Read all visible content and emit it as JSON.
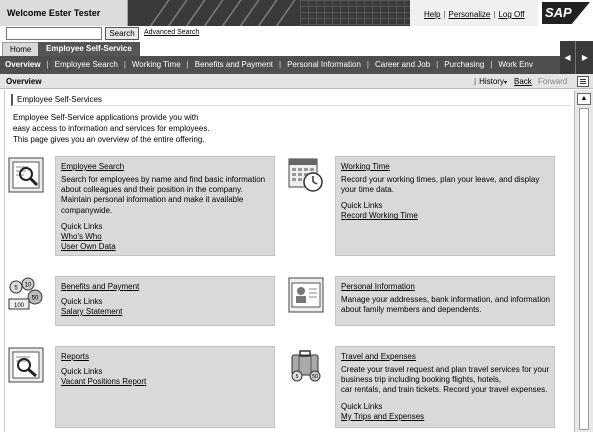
{
  "header": {
    "welcome": "Welcome Ester Tester",
    "links": [
      "Help",
      "Personalize",
      "Log Off"
    ],
    "logo_text": "SAP"
  },
  "search": {
    "value": "",
    "button": "Search",
    "advanced": "Advanced Search"
  },
  "tabs": [
    {
      "label": "Home",
      "active": false
    },
    {
      "label": "Employee Self-Service",
      "active": true
    }
  ],
  "nav": {
    "items": [
      "Overview",
      "Employee Search",
      "Working Time",
      "Benefits and Payment",
      "Personal Information",
      "Career and Job",
      "Purchasing",
      "Work Env"
    ]
  },
  "overview_bar": {
    "title": "Overview",
    "history": "History",
    "back": "Back",
    "forward": "Forward"
  },
  "content": {
    "section_title": "Employee Self-Services",
    "intro_lines": [
      "Employee Self-Service applications provide you with",
      "easy access to information and services for employees.",
      "This page gives you an overview of the entire offering."
    ],
    "quick_links_label": "Quick Links"
  },
  "cards": {
    "employee_search": {
      "title": "Employee Search",
      "desc_lines": [
        "Search for employees by name and find basic information",
        "about colleagues and their position in the company.",
        "Maintain personal information and make it available",
        "companywide."
      ],
      "links": [
        "Who's Who",
        "User Own Data"
      ]
    },
    "working_time": {
      "title": "Working Time",
      "desc_lines": [
        "Record your working times, plan your leave, and display",
        "your time data."
      ],
      "links": [
        "Record Working Time"
      ]
    },
    "benefits": {
      "title": "Benefits and Payment",
      "desc_lines": [],
      "links": [
        "Salary Statement"
      ]
    },
    "personal_info": {
      "title": "Personal Information",
      "desc_lines": [
        "Manage your addresses, bank information, and information",
        "about family members and dependents."
      ],
      "links": []
    },
    "reports": {
      "title": "Reports",
      "desc_lines": [],
      "links": [
        "Vacant Positions Report"
      ]
    },
    "travel": {
      "title": "Travel and Expenses",
      "desc_lines": [
        "Create your travel request and plan travel services for your",
        "business trip including booking flights, hotels,",
        "car rentals, and train tickets. Record your travel expenses."
      ],
      "links": [
        "My Trips and Expenses"
      ]
    }
  },
  "icons": {
    "employee_search": "magnifier-document-icon",
    "working_time": "calendar-clock-icon",
    "benefits": "coins-icon",
    "personal_info": "id-card-icon",
    "reports": "magnifier-report-icon",
    "travel": "suitcase-coins-icon"
  },
  "coin_labels": [
    "5",
    "10",
    "50",
    "100"
  ]
}
